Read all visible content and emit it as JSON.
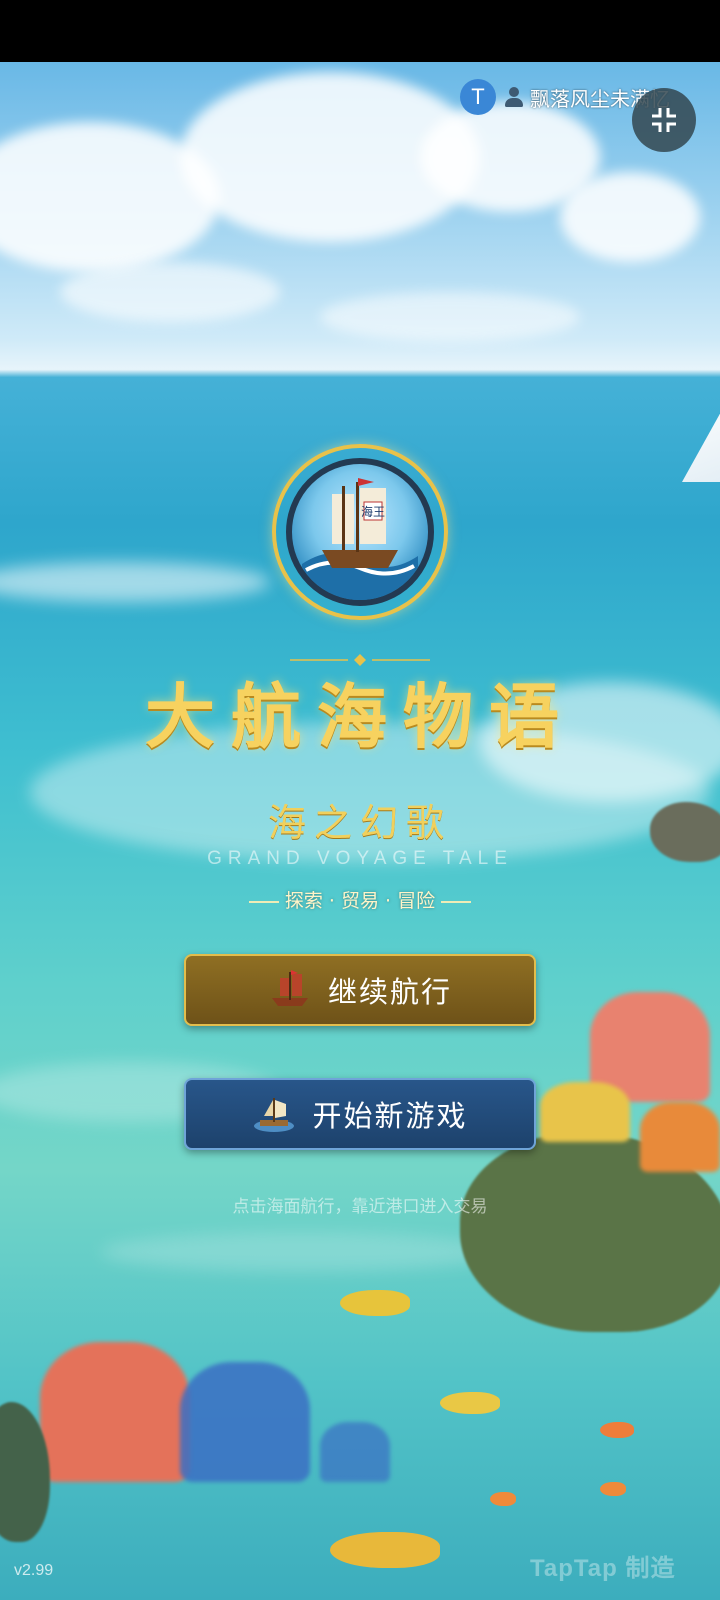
{
  "user": {
    "avatar_initial": "T",
    "name": "飘落风尘未满忆"
  },
  "title": {
    "main": "大航海物语",
    "subtitle": "海之幻歌",
    "english": "GRAND VOYAGE TALE",
    "tagline": "探索 · 贸易 · 冒险"
  },
  "buttons": {
    "continue_label": "继续航行",
    "new_game_label": "开始新游戏"
  },
  "hint": "点击海面航行，靠近港口进入交易",
  "version": "v2.99",
  "watermark": "TapTap 制造",
  "emblem_text": "海王",
  "colors": {
    "gold": "#f7d25f",
    "continue_button": "#8f6f23",
    "new_game_button": "#28568a",
    "avatar": "#3a87d6"
  },
  "icons": {
    "exit_fullscreen": "exit-fullscreen-icon",
    "continue": "galleon-icon",
    "new_game": "raft-icon",
    "user": "user-icon"
  }
}
